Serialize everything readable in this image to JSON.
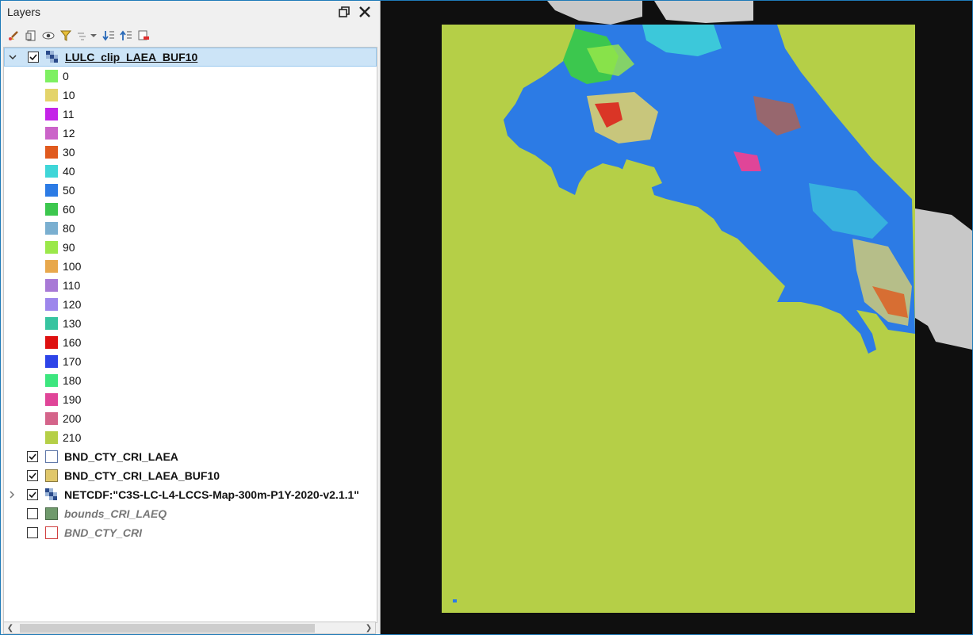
{
  "panel": {
    "title": "Layers",
    "float_icon": "restore-icon",
    "close_icon": "close-icon",
    "toolbar_icons": [
      "style-brush-icon",
      "add-group-icon",
      "visibility-eye-icon",
      "filter-icon",
      "filter-legend-dropdown-icon",
      "expand-all-icon",
      "collapse-all-icon",
      "remove-layer-icon"
    ]
  },
  "layers": {
    "main": {
      "name": "LULC_clip_LAEA_BUF10"
    },
    "legend": [
      {
        "label": "0",
        "color": "#7ef062"
      },
      {
        "label": "10",
        "color": "#e4d46a"
      },
      {
        "label": "11",
        "color": "#c423e8"
      },
      {
        "label": "12",
        "color": "#cb63c9"
      },
      {
        "label": "30",
        "color": "#e05a1e"
      },
      {
        "label": "40",
        "color": "#3fd6d8"
      },
      {
        "label": "50",
        "color": "#2c7be5"
      },
      {
        "label": "60",
        "color": "#3cc74e"
      },
      {
        "label": "80",
        "color": "#7aafd0"
      },
      {
        "label": "90",
        "color": "#9be84a"
      },
      {
        "label": "100",
        "color": "#e8a84c"
      },
      {
        "label": "110",
        "color": "#a879d6"
      },
      {
        "label": "120",
        "color": "#9d86ec"
      },
      {
        "label": "130",
        "color": "#37c4a0"
      },
      {
        "label": "160",
        "color": "#de1010"
      },
      {
        "label": "170",
        "color": "#2d44e8"
      },
      {
        "label": "180",
        "color": "#3ce67e"
      },
      {
        "label": "190",
        "color": "#e04598"
      },
      {
        "label": "200",
        "color": "#d4648a"
      },
      {
        "label": "210",
        "color": "#b5cf47"
      }
    ],
    "others": [
      {
        "name": "BND_CTY_CRI_LAEA",
        "checked": true,
        "style": "bold",
        "swatch_fill": "#ffffff",
        "swatch_border": "#5f77a8",
        "kind": "vector"
      },
      {
        "name": "BND_CTY_CRI_LAEA_BUF10",
        "checked": true,
        "style": "bold",
        "swatch_fill": "#e0c76a",
        "swatch_border": "#8a7a40",
        "kind": "vector"
      },
      {
        "name": "NETCDF:\"C3S-LC-L4-LCCS-Map-300m-P1Y-2020-v2.1.1\"",
        "checked": true,
        "style": "bold",
        "kind": "raster"
      },
      {
        "name": "bounds_CRI_LAEQ",
        "checked": false,
        "style": "italic",
        "swatch_fill": "#6f9a6c",
        "swatch_border": "#4a6a48",
        "kind": "vector"
      },
      {
        "name": "BND_CTY_CRI",
        "checked": false,
        "style": "italic",
        "swatch_fill": "#ffffff",
        "swatch_border": "#d04040",
        "kind": "vector"
      }
    ]
  },
  "map": {
    "background": "#0f0f0f",
    "fill_color": "#b5cf47",
    "land_color": "#2c7be5"
  }
}
